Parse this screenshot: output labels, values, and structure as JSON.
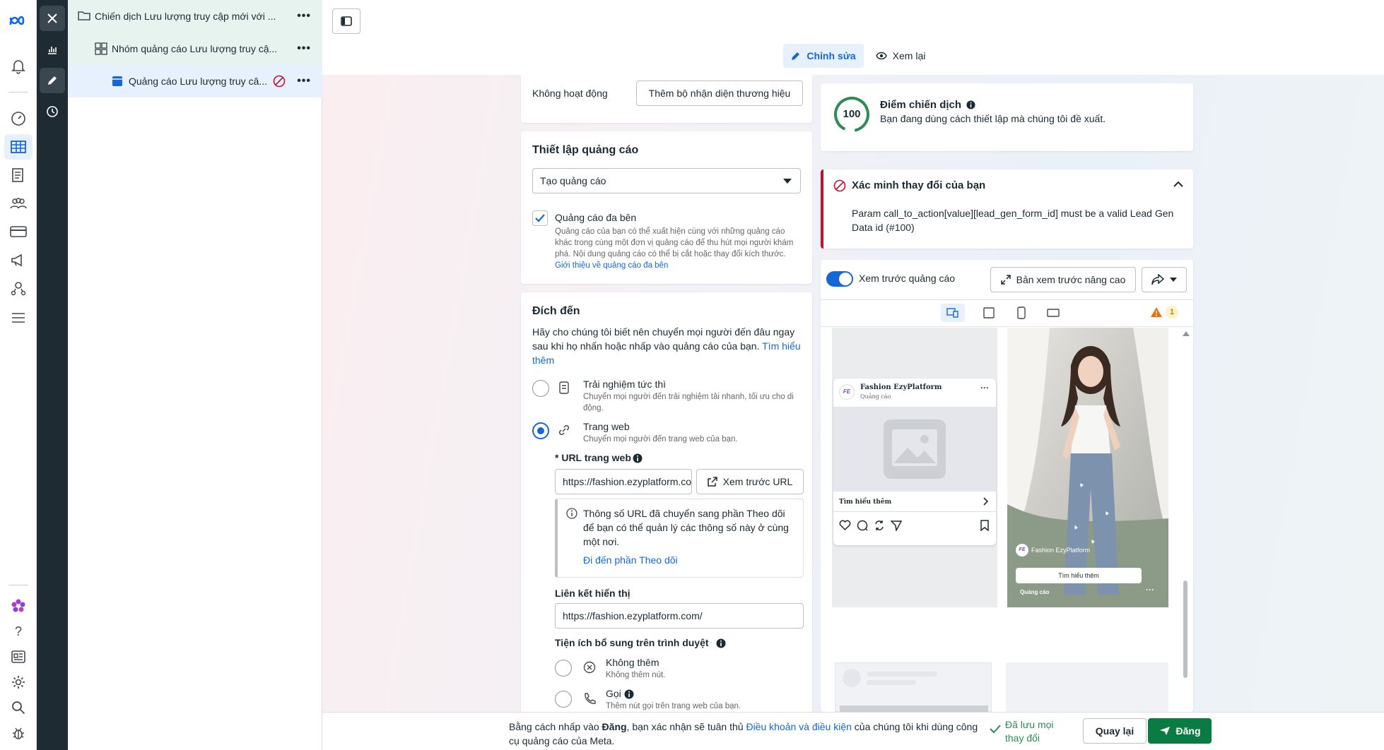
{
  "tree": {
    "campaign": "Chiến dịch Lưu lượng truy cập mới với ...",
    "adset": "Nhóm quảng cáo Lưu lượng truy cậ...",
    "ad": "Quảng cáo Lưu lượng truy câ...",
    "more": "•••"
  },
  "tabs": {
    "edit": "Chỉnh sửa",
    "review": "Xem lại"
  },
  "identity": {
    "status": "Không hoạt động",
    "add_brand": "Thêm bộ nhận diện thương hiệu"
  },
  "ad_setup": {
    "title": "Thiết lập quảng cáo",
    "select_value": "Tạo quảng cáo",
    "multi_title": "Quảng cáo đa bên",
    "multi_desc": "Quảng cáo của bạn có thể xuất hiện cùng với những quảng cáo khác trong cùng một đơn vị quảng cáo để thu hút mọi người khám phá. Nội dung quảng cáo có thể bị cắt hoặc thay đổi kích thước.",
    "multi_link": "Giới thiệu về quảng cáo đa bên"
  },
  "destination": {
    "title": "Đích đến",
    "desc": "Hãy cho chúng tôi biết nên chuyển mọi người đến đâu ngay sau khi họ nhấn hoặc nhấp vào quảng cáo của bạn.",
    "learn_more": "Tìm hiểu thêm",
    "options": [
      {
        "title": "Trải nghiệm tức thì",
        "desc": "Chuyển mọi người đến trải nghiệm tải nhanh, tối ưu cho di động."
      },
      {
        "title": "Trang web",
        "desc": "Chuyển mọi người đến trang web của bạn."
      }
    ],
    "url_label": "* URL trang web",
    "url_value": "https://fashion.ezyplatform.com/",
    "preview_url": "Xem trước URL",
    "info_text": "Thông số URL đã chuyển sang phần Theo dõi để bạn có thể quản lý các thông số này ở cùng một nơi.",
    "info_link": "Đi đến phần Theo dõi",
    "display_link_label": "Liên kết hiển thị",
    "display_link_value": "https://fashion.ezyplatform.com/",
    "ext_title": "Tiện ích bổ sung trên trình duyệt",
    "ext_options": [
      {
        "title": "Không thêm",
        "desc": "Không thêm nút."
      },
      {
        "title": "Gọi",
        "desc": "Thêm nút gọi trên trang web của bạn."
      }
    ]
  },
  "score": {
    "value": "100",
    "title": "Điểm chiến dịch",
    "desc": "Bạn đang dùng cách thiết lập mà chúng tôi đề xuất."
  },
  "verify": {
    "title": "Xác minh thay đổi của bạn",
    "message": "Param call_to_action[value][lead_gen_form_id] must be a valid Lead Gen Data id (#100)"
  },
  "preview": {
    "toggle_label": "Xem trước quảng cáo",
    "advanced": "Bản xem trước nâng cao",
    "warning_count": "1",
    "brand": "Fashion EzyPlatform",
    "sponsored": "Quảng cáo",
    "cta": "Tìm hiểu thêm",
    "logo_text": "FE"
  },
  "footer": {
    "terms_pre": "Bằng cách nhấp vào ",
    "terms_bold": "Đăng",
    "terms_mid": ", bạn xác nhận sẽ tuân thủ ",
    "terms_link": "Điều khoản và điều kiện",
    "terms_post": " của chúng tôi khi dùng công cụ quảng cáo của Meta.",
    "saved": "Đã lưu mọi thay đổi",
    "back": "Quay lại",
    "publish": "Đăng"
  }
}
